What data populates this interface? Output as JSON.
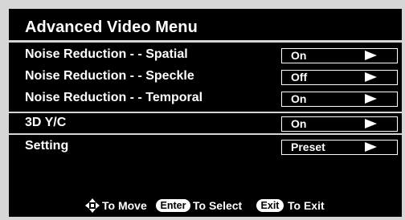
{
  "menu": {
    "title": "Advanced Video Menu",
    "items": [
      {
        "label": "Noise Reduction - - Spatial",
        "value": "On"
      },
      {
        "label": "Noise Reduction - - Speckle",
        "value": "Off"
      },
      {
        "label": "Noise Reduction - - Temporal",
        "value": "On"
      },
      {
        "label": "3D Y/C",
        "value": "On"
      },
      {
        "label": "Setting",
        "value": "Preset"
      }
    ]
  },
  "footer": {
    "move_label": "To Move",
    "enter_key": "Enter",
    "select_label": "To Select",
    "exit_key": "Exit",
    "exit_label": "To Exit",
    "move_icon": "four-way-arrow-icon"
  },
  "colors": {
    "background": "#000000",
    "text": "#ffffff",
    "frame": "#d6d6d6"
  }
}
